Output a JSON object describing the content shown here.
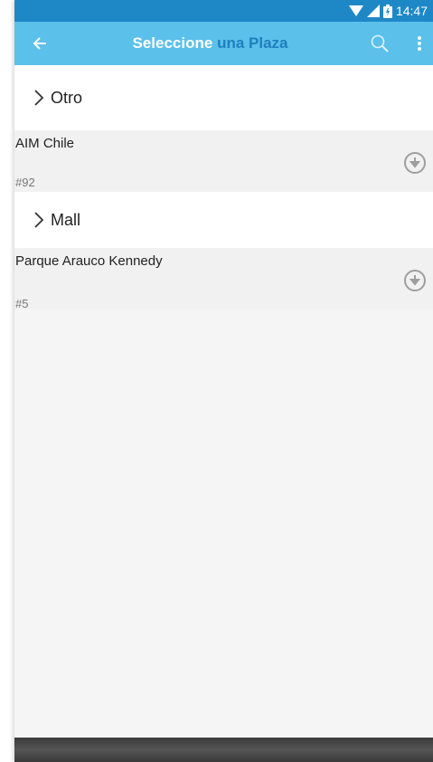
{
  "status_bar": {
    "time": "14:47"
  },
  "app_bar": {
    "title_part1": "Seleccione ",
    "title_part2": "una Plaza",
    "back_icon": "arrow-left-icon",
    "search_icon": "search-icon",
    "menu_icon": "more-vert-icon"
  },
  "groups": [
    {
      "label": "Otro",
      "items": [
        {
          "name": "AIM Chile",
          "number": "#92"
        }
      ]
    },
    {
      "label": "Mall",
      "items": [
        {
          "name": "Parque Arauco Kennedy",
          "number": "#5"
        }
      ]
    }
  ],
  "colors": {
    "status_bar": "#1e88c7",
    "app_bar": "#5bc0ea",
    "title_accent": "#1f7fbe"
  }
}
